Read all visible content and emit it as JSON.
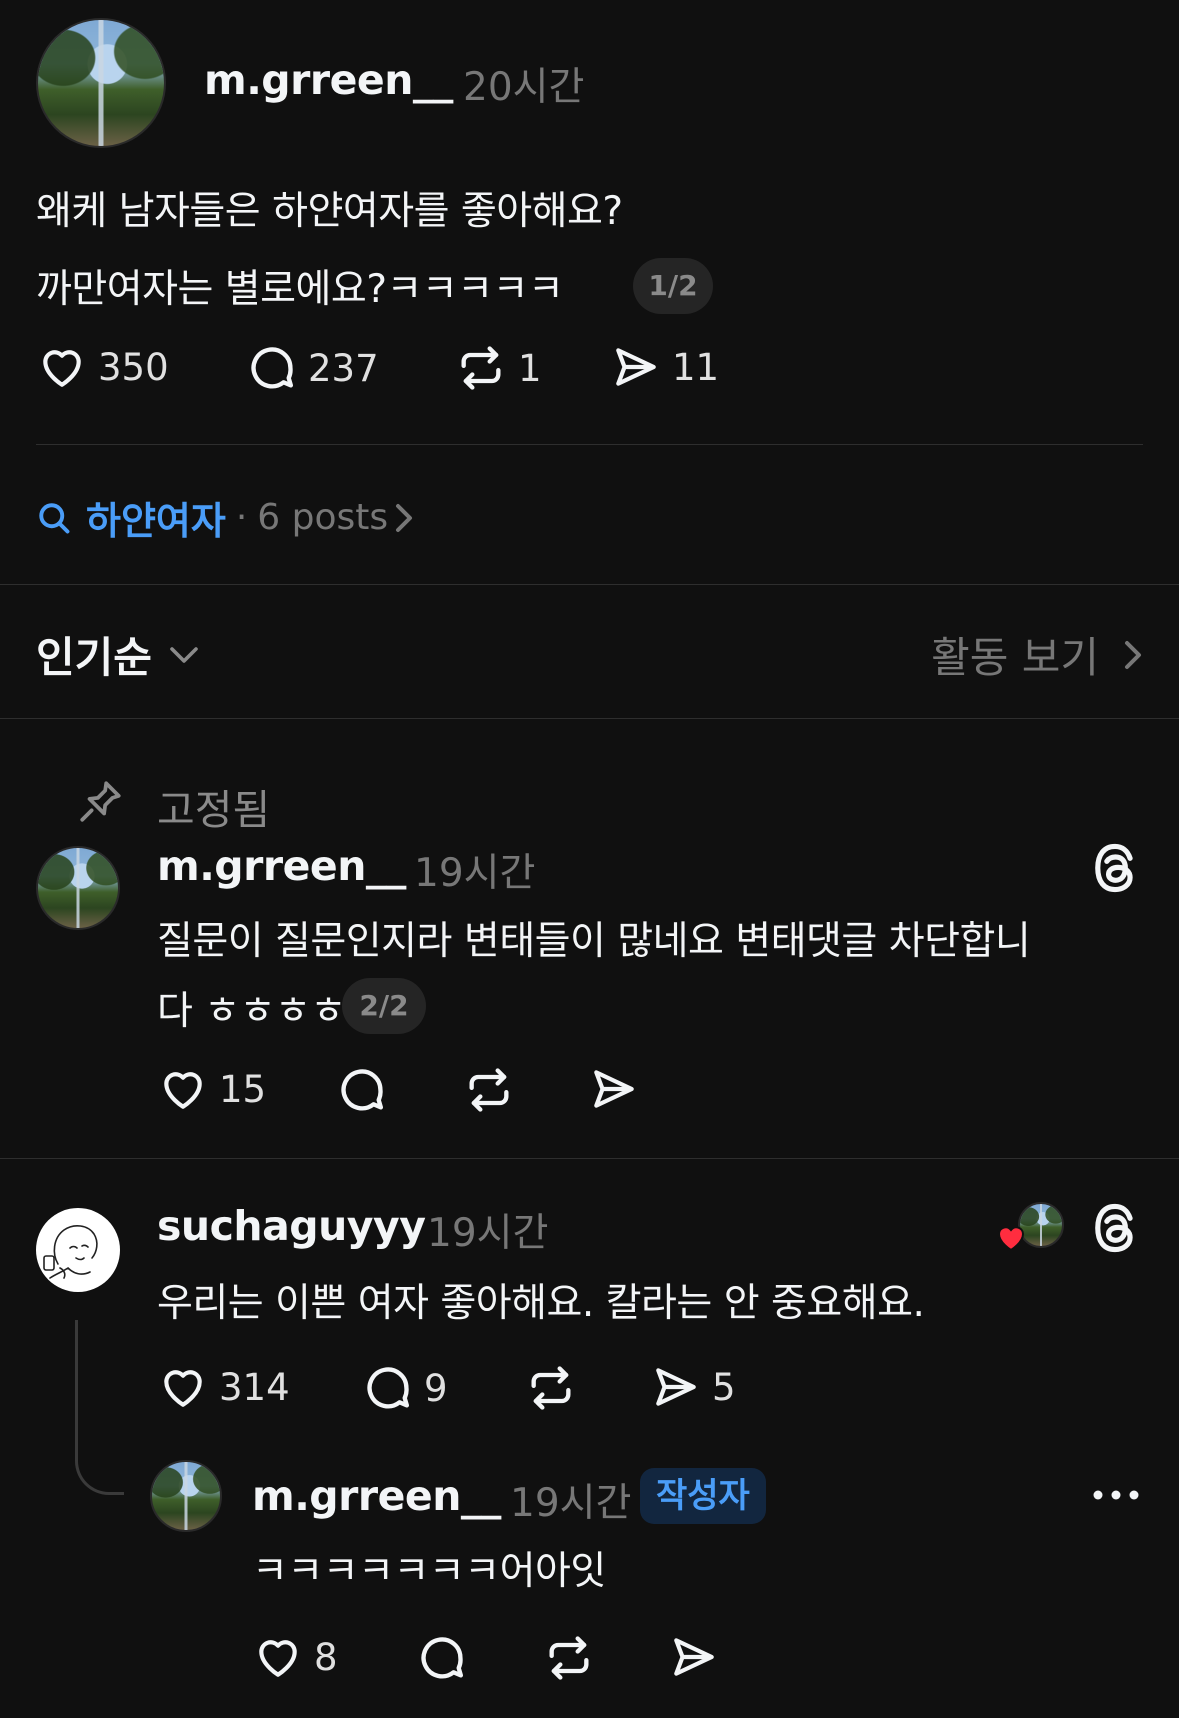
{
  "post": {
    "username": "m.grreen__",
    "time": "20시간",
    "line1": "왜케 남자들은 하얀여자를 좋아해요?",
    "line2": "까만여자는 별로에요?ㅋㅋㅋㅋㅋ",
    "pager": "1/2",
    "likes": "350",
    "comments": "237",
    "reposts": "1",
    "shares": "11"
  },
  "topic": {
    "tag": "하얀여자",
    "separator": "·",
    "count": "6 posts"
  },
  "sort": {
    "label": "인기순",
    "activity": "활동 보기"
  },
  "pinned": {
    "label": "고정됨",
    "username": "m.grreen__",
    "time": "19시간",
    "line1": "질문이 질문인지라 변태들이 많네요 변태댓글 차단합니",
    "line2": "다 ㅎㅎㅎㅎ",
    "pager": "2/2",
    "likes": "15"
  },
  "reply": {
    "username": "suchaguyyy",
    "time": "19시간",
    "text": "우리는 이쁜 여자 좋아해요. 칼라는 안 중요해요.",
    "likes": "314",
    "comments": "9",
    "shares": "5"
  },
  "nested": {
    "username": "m.grreen__",
    "time": "19시간",
    "badge": "작성자",
    "text": "ㅋㅋㅋㅋㅋㅋㅋ어아잇",
    "likes": "8"
  },
  "colors": {
    "background": "#101010",
    "accent_blue": "#4a9df8",
    "heart_red": "#ff2d3f"
  }
}
